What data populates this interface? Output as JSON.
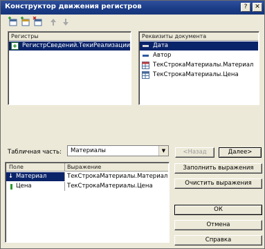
{
  "window": {
    "title": "Конструктор движения регистров"
  },
  "toolbar": {
    "icons": [
      "add-row-icon",
      "add-group-icon",
      "delete-icon",
      "move-up-icon",
      "move-down-icon"
    ]
  },
  "registers": {
    "header": "Регистры",
    "items": [
      {
        "label": "РегистрСведений.ТекиРеализации",
        "selected": true
      }
    ]
  },
  "requisites": {
    "header": "Реквизиты документа",
    "items": [
      {
        "label": "Дата",
        "selected": true
      },
      {
        "label": "Автор",
        "selected": false
      },
      {
        "label": "ТекСтрокаМатериалы.Материал",
        "selected": false
      },
      {
        "label": "ТекСтрокаМатериалы.Цена",
        "selected": false
      }
    ]
  },
  "tabular": {
    "label": "Табличная часть:",
    "value": "Материалы"
  },
  "nav": {
    "back_label": "<Назад",
    "next_label": "Далее>"
  },
  "grid": {
    "col_field": "Поле",
    "col_expr": "Выражение",
    "rows": [
      {
        "field": "Материал",
        "expr": "ТекСтрокаМатериалы.Материал",
        "selected": true
      },
      {
        "field": "Цена",
        "expr": "ТекСтрокаМатериалы.Цена",
        "selected": false
      }
    ]
  },
  "buttons": {
    "fill": "Заполнить выражения",
    "clear": "Очистить выражения",
    "ok": "ОК",
    "cancel": "Отмена",
    "help": "Справка"
  }
}
